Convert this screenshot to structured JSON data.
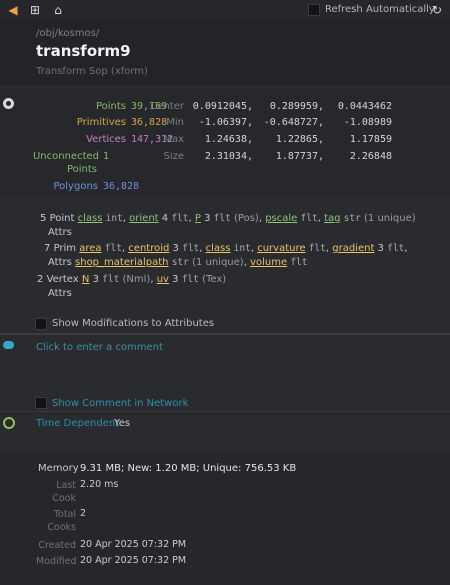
{
  "toolbar": {
    "refresh_label": "Refresh Automatically",
    "pin_color": "#e8a040"
  },
  "header": {
    "path": "/obj/kosmos/",
    "node_name": "transform9",
    "node_type": "Transform Sop (xform)"
  },
  "geometry": {
    "points_label": "Points",
    "points_value": "39,169",
    "primitives_label": "Primitives",
    "primitives_value": "36,828",
    "vertices_label": "Vertices",
    "vertices_value": "147,312",
    "unconnected_label": "Unconnected",
    "unconnected_value": "1",
    "unconnected_label2": "Points",
    "polygons_label": "Polygons",
    "polygons_value": "36,828",
    "center_label": "Center",
    "center": [
      "0.0912045,",
      "0.289959,",
      "0.0443462"
    ],
    "min_label": "Min",
    "min": [
      "-1.06397,",
      "-0.648727,",
      "-1.08989"
    ],
    "max_label": "Max",
    "max": [
      "1.24638,",
      "1.22865,",
      "1.17859"
    ],
    "size_label": "Size",
    "size": [
      "2.31034,",
      "1.87737,",
      "2.26848"
    ]
  },
  "attributes": {
    "point": {
      "count": "5",
      "label": "Point",
      "label2": "Attrs",
      "items": [
        {
          "name": "class",
          "type": "int",
          "sep": ","
        },
        {
          "name": "orient",
          "type": "4",
          "type2": "flt",
          "sep": ","
        },
        {
          "name": "P",
          "type": "3",
          "type2": "flt",
          "extra": "(Pos)",
          "sep": ","
        },
        {
          "name": "pscale",
          "type": "flt",
          "sep": ","
        },
        {
          "name": "tag",
          "type": "str",
          "extra": "(1 unique)"
        }
      ]
    },
    "prim": {
      "count": "7",
      "label": "Prim",
      "label2": "Attrs",
      "items": [
        {
          "name": "area",
          "type": "flt",
          "sep": ","
        },
        {
          "name": "centroid",
          "type": "3",
          "type2": "flt",
          "sep": ","
        },
        {
          "name": "class",
          "type": "int",
          "sep": ","
        },
        {
          "name": "curvature",
          "type": "flt",
          "sep": ","
        },
        {
          "name": "gradient",
          "type": "3",
          "type2": "flt",
          "sep": ","
        },
        {
          "name": "shop_materialpath",
          "type": "str",
          "extra": "(1 unique)",
          "sep": ","
        },
        {
          "name": "volume",
          "type": "flt"
        }
      ]
    },
    "vertex": {
      "count": "2",
      "label": "Vertex",
      "label2": "Attrs",
      "items": [
        {
          "name": "N",
          "type": "3",
          "type2": "flt",
          "extra": "(Nml)",
          "sep": ","
        },
        {
          "name": "uv",
          "type": "3",
          "type2": "flt",
          "extra": "(Tex)"
        }
      ]
    }
  },
  "options": {
    "show_modifications": "Show Modifications to Attributes",
    "comment_placeholder": "Click to enter a comment",
    "show_comment_network": "Show Comment in Network",
    "time_dependent_label": "Time Dependent",
    "time_dependent_value": "Yes"
  },
  "memory": {
    "label": "Memory",
    "value": "9.31 MB; New: 1.20 MB; Unique: 756.53 KB",
    "last_cook_label": "Last\nCook",
    "last_cook_value": "2.20 ms",
    "total_cooks_label": "Total\nCooks",
    "total_cooks_value": "2",
    "created_label": "Created",
    "created_value": "20 Apr 2025 07:32 PM",
    "modified_label": "Modified",
    "modified_value": "20 Apr 2025 07:32 PM"
  }
}
